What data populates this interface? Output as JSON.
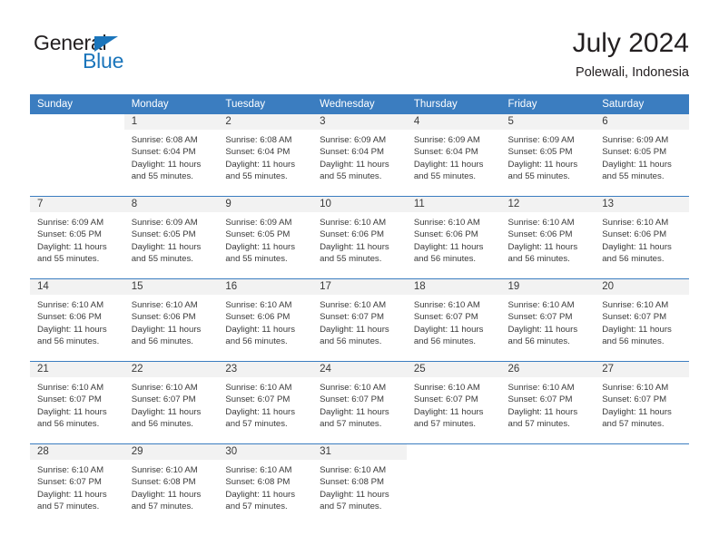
{
  "brand": {
    "name_part1": "General",
    "name_part2": "Blue",
    "accent_color": "#1b75bb",
    "triangle_icon": "triangle-icon"
  },
  "header": {
    "title": "July 2024",
    "location": "Polewali, Indonesia"
  },
  "calendar": {
    "header_bg": "#3b7dc0",
    "daynum_bg": "#f2f2f2",
    "weekday_headers": [
      "Sunday",
      "Monday",
      "Tuesday",
      "Wednesday",
      "Thursday",
      "Friday",
      "Saturday"
    ],
    "weeks": [
      [
        {
          "day": "",
          "sunrise": "",
          "sunset": "",
          "daylight1": "",
          "daylight2": ""
        },
        {
          "day": "1",
          "sunrise": "Sunrise: 6:08 AM",
          "sunset": "Sunset: 6:04 PM",
          "daylight1": "Daylight: 11 hours",
          "daylight2": "and 55 minutes."
        },
        {
          "day": "2",
          "sunrise": "Sunrise: 6:08 AM",
          "sunset": "Sunset: 6:04 PM",
          "daylight1": "Daylight: 11 hours",
          "daylight2": "and 55 minutes."
        },
        {
          "day": "3",
          "sunrise": "Sunrise: 6:09 AM",
          "sunset": "Sunset: 6:04 PM",
          "daylight1": "Daylight: 11 hours",
          "daylight2": "and 55 minutes."
        },
        {
          "day": "4",
          "sunrise": "Sunrise: 6:09 AM",
          "sunset": "Sunset: 6:04 PM",
          "daylight1": "Daylight: 11 hours",
          "daylight2": "and 55 minutes."
        },
        {
          "day": "5",
          "sunrise": "Sunrise: 6:09 AM",
          "sunset": "Sunset: 6:05 PM",
          "daylight1": "Daylight: 11 hours",
          "daylight2": "and 55 minutes."
        },
        {
          "day": "6",
          "sunrise": "Sunrise: 6:09 AM",
          "sunset": "Sunset: 6:05 PM",
          "daylight1": "Daylight: 11 hours",
          "daylight2": "and 55 minutes."
        }
      ],
      [
        {
          "day": "7",
          "sunrise": "Sunrise: 6:09 AM",
          "sunset": "Sunset: 6:05 PM",
          "daylight1": "Daylight: 11 hours",
          "daylight2": "and 55 minutes."
        },
        {
          "day": "8",
          "sunrise": "Sunrise: 6:09 AM",
          "sunset": "Sunset: 6:05 PM",
          "daylight1": "Daylight: 11 hours",
          "daylight2": "and 55 minutes."
        },
        {
          "day": "9",
          "sunrise": "Sunrise: 6:09 AM",
          "sunset": "Sunset: 6:05 PM",
          "daylight1": "Daylight: 11 hours",
          "daylight2": "and 55 minutes."
        },
        {
          "day": "10",
          "sunrise": "Sunrise: 6:10 AM",
          "sunset": "Sunset: 6:06 PM",
          "daylight1": "Daylight: 11 hours",
          "daylight2": "and 55 minutes."
        },
        {
          "day": "11",
          "sunrise": "Sunrise: 6:10 AM",
          "sunset": "Sunset: 6:06 PM",
          "daylight1": "Daylight: 11 hours",
          "daylight2": "and 56 minutes."
        },
        {
          "day": "12",
          "sunrise": "Sunrise: 6:10 AM",
          "sunset": "Sunset: 6:06 PM",
          "daylight1": "Daylight: 11 hours",
          "daylight2": "and 56 minutes."
        },
        {
          "day": "13",
          "sunrise": "Sunrise: 6:10 AM",
          "sunset": "Sunset: 6:06 PM",
          "daylight1": "Daylight: 11 hours",
          "daylight2": "and 56 minutes."
        }
      ],
      [
        {
          "day": "14",
          "sunrise": "Sunrise: 6:10 AM",
          "sunset": "Sunset: 6:06 PM",
          "daylight1": "Daylight: 11 hours",
          "daylight2": "and 56 minutes."
        },
        {
          "day": "15",
          "sunrise": "Sunrise: 6:10 AM",
          "sunset": "Sunset: 6:06 PM",
          "daylight1": "Daylight: 11 hours",
          "daylight2": "and 56 minutes."
        },
        {
          "day": "16",
          "sunrise": "Sunrise: 6:10 AM",
          "sunset": "Sunset: 6:06 PM",
          "daylight1": "Daylight: 11 hours",
          "daylight2": "and 56 minutes."
        },
        {
          "day": "17",
          "sunrise": "Sunrise: 6:10 AM",
          "sunset": "Sunset: 6:07 PM",
          "daylight1": "Daylight: 11 hours",
          "daylight2": "and 56 minutes."
        },
        {
          "day": "18",
          "sunrise": "Sunrise: 6:10 AM",
          "sunset": "Sunset: 6:07 PM",
          "daylight1": "Daylight: 11 hours",
          "daylight2": "and 56 minutes."
        },
        {
          "day": "19",
          "sunrise": "Sunrise: 6:10 AM",
          "sunset": "Sunset: 6:07 PM",
          "daylight1": "Daylight: 11 hours",
          "daylight2": "and 56 minutes."
        },
        {
          "day": "20",
          "sunrise": "Sunrise: 6:10 AM",
          "sunset": "Sunset: 6:07 PM",
          "daylight1": "Daylight: 11 hours",
          "daylight2": "and 56 minutes."
        }
      ],
      [
        {
          "day": "21",
          "sunrise": "Sunrise: 6:10 AM",
          "sunset": "Sunset: 6:07 PM",
          "daylight1": "Daylight: 11 hours",
          "daylight2": "and 56 minutes."
        },
        {
          "day": "22",
          "sunrise": "Sunrise: 6:10 AM",
          "sunset": "Sunset: 6:07 PM",
          "daylight1": "Daylight: 11 hours",
          "daylight2": "and 56 minutes."
        },
        {
          "day": "23",
          "sunrise": "Sunrise: 6:10 AM",
          "sunset": "Sunset: 6:07 PM",
          "daylight1": "Daylight: 11 hours",
          "daylight2": "and 57 minutes."
        },
        {
          "day": "24",
          "sunrise": "Sunrise: 6:10 AM",
          "sunset": "Sunset: 6:07 PM",
          "daylight1": "Daylight: 11 hours",
          "daylight2": "and 57 minutes."
        },
        {
          "day": "25",
          "sunrise": "Sunrise: 6:10 AM",
          "sunset": "Sunset: 6:07 PM",
          "daylight1": "Daylight: 11 hours",
          "daylight2": "and 57 minutes."
        },
        {
          "day": "26",
          "sunrise": "Sunrise: 6:10 AM",
          "sunset": "Sunset: 6:07 PM",
          "daylight1": "Daylight: 11 hours",
          "daylight2": "and 57 minutes."
        },
        {
          "day": "27",
          "sunrise": "Sunrise: 6:10 AM",
          "sunset": "Sunset: 6:07 PM",
          "daylight1": "Daylight: 11 hours",
          "daylight2": "and 57 minutes."
        }
      ],
      [
        {
          "day": "28",
          "sunrise": "Sunrise: 6:10 AM",
          "sunset": "Sunset: 6:07 PM",
          "daylight1": "Daylight: 11 hours",
          "daylight2": "and 57 minutes."
        },
        {
          "day": "29",
          "sunrise": "Sunrise: 6:10 AM",
          "sunset": "Sunset: 6:08 PM",
          "daylight1": "Daylight: 11 hours",
          "daylight2": "and 57 minutes."
        },
        {
          "day": "30",
          "sunrise": "Sunrise: 6:10 AM",
          "sunset": "Sunset: 6:08 PM",
          "daylight1": "Daylight: 11 hours",
          "daylight2": "and 57 minutes."
        },
        {
          "day": "31",
          "sunrise": "Sunrise: 6:10 AM",
          "sunset": "Sunset: 6:08 PM",
          "daylight1": "Daylight: 11 hours",
          "daylight2": "and 57 minutes."
        },
        {
          "day": "",
          "sunrise": "",
          "sunset": "",
          "daylight1": "",
          "daylight2": ""
        },
        {
          "day": "",
          "sunrise": "",
          "sunset": "",
          "daylight1": "",
          "daylight2": ""
        },
        {
          "day": "",
          "sunrise": "",
          "sunset": "",
          "daylight1": "",
          "daylight2": ""
        }
      ]
    ]
  }
}
